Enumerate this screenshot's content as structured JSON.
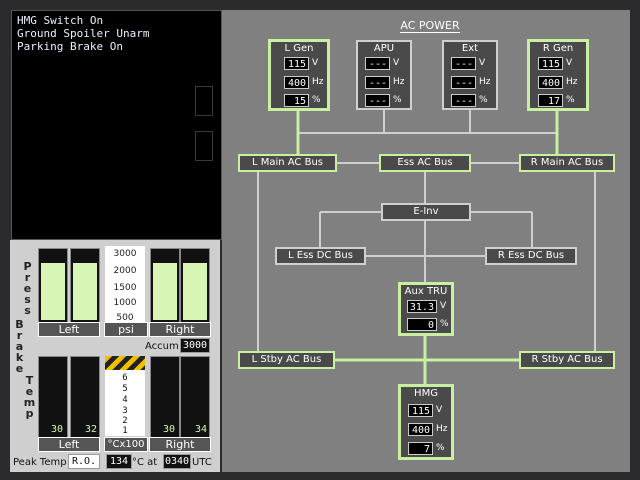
{
  "messages": [
    "HMG Switch On",
    "Ground Spoiler Unarm",
    "Parking Brake On"
  ],
  "brake": {
    "vertical_label_1": "Press",
    "vertical_label_2": "Brake",
    "vertical_label_3": "Temp",
    "press_scale_ticks": [
      "3000",
      "2000",
      "1500",
      "1000",
      "500"
    ],
    "press_left_label": "Left",
    "press_unit_label": "psi",
    "press_right_label": "Right",
    "press_left_level": 0.95,
    "press_right_level": 0.95,
    "accum_label": "Accum",
    "accum_value": "3000",
    "temp_scale_digits": [
      "6",
      "5",
      "4",
      "3",
      "2",
      "1"
    ],
    "temp_left_label": "Left",
    "temp_unit_label": "°Cx100",
    "temp_right_label": "Right",
    "temp_values": [
      "30",
      "32",
      "30",
      "34"
    ],
    "peak_temp_label": "Peak Temp",
    "peak_temp_source": "R.O.",
    "peak_temp_value": "134",
    "peak_temp_unit": "°C at",
    "peak_time": "0340",
    "peak_time_unit": "UTC"
  },
  "ac_power": {
    "title": "AC POWER",
    "l_gen": {
      "title": "L Gen",
      "volts": "115",
      "hz": "400",
      "pct": "15"
    },
    "apu": {
      "title": "APU",
      "volts": "---",
      "hz": "---",
      "pct": "---"
    },
    "ext": {
      "title": "Ext",
      "volts": "---",
      "hz": "---",
      "pct": "---"
    },
    "r_gen": {
      "title": "R Gen",
      "volts": "115",
      "hz": "400",
      "pct": "17"
    },
    "units": {
      "v": "V",
      "hz": "Hz",
      "pct": "%"
    },
    "buses": {
      "l_main": "L Main AC Bus",
      "ess_ac": "Ess AC Bus",
      "r_main": "R Main AC Bus",
      "e_inv": "E-Inv",
      "l_ess_dc": "L Ess DC Bus",
      "r_ess_dc": "R Ess DC Bus",
      "l_stby": "L Stby AC Bus",
      "r_stby": "R Stby AC Bus"
    },
    "aux_tru": {
      "title": "Aux TRU",
      "volts": "31.3",
      "pct": "0"
    },
    "hmg": {
      "title": "HMG",
      "volts": "115",
      "hz": "400",
      "pct": "7"
    }
  }
}
